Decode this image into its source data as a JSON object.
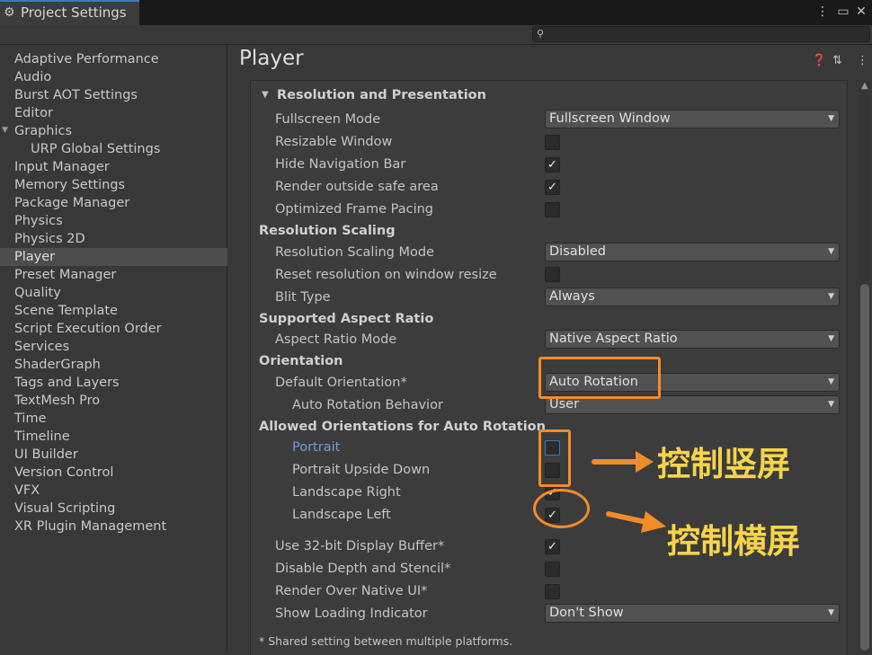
{
  "window": {
    "title": "Project Settings",
    "icons": [
      "gear-icon",
      "kebab-menu-icon",
      "maximize-icon",
      "close-icon"
    ]
  },
  "search": {
    "placeholder": "",
    "value": ""
  },
  "sidebar": {
    "items": [
      {
        "label": "Adaptive Performance"
      },
      {
        "label": "Audio"
      },
      {
        "label": "Burst AOT Settings"
      },
      {
        "label": "Editor"
      },
      {
        "label": "Graphics",
        "expanded": true
      },
      {
        "label": "URP Global Settings",
        "child": true
      },
      {
        "label": "Input Manager"
      },
      {
        "label": "Memory Settings"
      },
      {
        "label": "Package Manager"
      },
      {
        "label": "Physics"
      },
      {
        "label": "Physics 2D"
      },
      {
        "label": "Player",
        "selected": true
      },
      {
        "label": "Preset Manager"
      },
      {
        "label": "Quality"
      },
      {
        "label": "Scene Template"
      },
      {
        "label": "Script Execution Order"
      },
      {
        "label": "Services"
      },
      {
        "label": "ShaderGraph"
      },
      {
        "label": "Tags and Layers"
      },
      {
        "label": "TextMesh Pro"
      },
      {
        "label": "Time"
      },
      {
        "label": "Timeline"
      },
      {
        "label": "UI Builder"
      },
      {
        "label": "Version Control"
      },
      {
        "label": "VFX"
      },
      {
        "label": "Visual Scripting"
      },
      {
        "label": "XR Plugin Management"
      }
    ]
  },
  "main": {
    "title": "Player",
    "section": "Resolution and Presentation",
    "fullscreen_mode": {
      "label": "Fullscreen Mode",
      "value": "Fullscreen Window"
    },
    "resizable_window": {
      "label": "Resizable Window",
      "checked": false
    },
    "hide_navigation_bar": {
      "label": "Hide Navigation Bar",
      "checked": true
    },
    "render_outside_safe_area": {
      "label": "Render outside safe area",
      "checked": true
    },
    "optimized_frame_pacing": {
      "label": "Optimized Frame Pacing",
      "checked": false
    },
    "resolution_scaling_header": "Resolution Scaling",
    "resolution_scaling_mode": {
      "label": "Resolution Scaling Mode",
      "value": "Disabled"
    },
    "reset_resolution": {
      "label": "Reset resolution on window resize",
      "checked": false
    },
    "blit_type": {
      "label": "Blit Type",
      "value": "Always"
    },
    "aspect_ratio_header": "Supported Aspect Ratio",
    "aspect_ratio_mode": {
      "label": "Aspect Ratio Mode",
      "value": "Native Aspect Ratio"
    },
    "orientation_header": "Orientation",
    "default_orientation": {
      "label": "Default Orientation*",
      "value": "Auto Rotation"
    },
    "auto_rotation_behavior": {
      "label": "Auto Rotation Behavior",
      "value": "User"
    },
    "allowed_orientations_header": "Allowed Orientations for Auto Rotation",
    "portrait": {
      "label": "Portrait",
      "checked": false
    },
    "portrait_upside_down": {
      "label": "Portrait Upside Down",
      "checked": false
    },
    "landscape_right": {
      "label": "Landscape Right",
      "checked": true
    },
    "landscape_left": {
      "label": "Landscape Left",
      "checked": true
    },
    "use_32bit_buffer": {
      "label": "Use 32-bit Display Buffer*",
      "checked": true
    },
    "disable_depth_stencil": {
      "label": "Disable Depth and Stencil*",
      "checked": false
    },
    "render_over_native_ui": {
      "label": "Render Over Native UI*",
      "checked": false
    },
    "show_loading_indicator": {
      "label": "Show Loading Indicator",
      "value": "Don't Show"
    },
    "footnote": "* Shared setting between multiple platforms."
  },
  "annotations": {
    "portrait_note": "控制竖屏",
    "landscape_note": "控制横屏",
    "color": "#f28c28",
    "text_color": "#f7d44a"
  },
  "check_glyph": "✓"
}
